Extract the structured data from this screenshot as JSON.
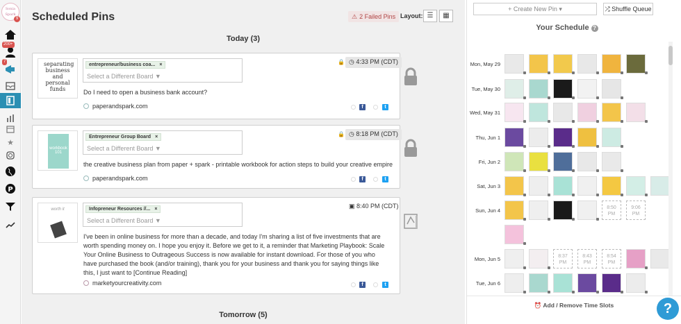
{
  "sidebar": {
    "logo_text": "Sonia Spark",
    "logo_badge": "9",
    "notif_badge": "200+",
    "tribes_badge": "7"
  },
  "header": {
    "title": "Scheduled Pins",
    "failed_pins": "2 Failed Pins",
    "layout_label": "Layout:"
  },
  "days": [
    {
      "label": "Today (3)"
    },
    {
      "label": "Tomorrow (5)"
    }
  ],
  "pins": [
    {
      "thumb_text": "separating business and personal funds",
      "board": "entrepreneur/business coa...",
      "board_placeholder": "Select a Different Board ▼",
      "time": "4:33 PM (CDT)",
      "description": "Do I need to open a business bank account?",
      "source": "paperandspark.com"
    },
    {
      "thumb_text": "workbook 101",
      "board": "Entrepreneur Group Board",
      "board_placeholder": "Select a Different Board ▼",
      "time": "8:18 PM (CDT)",
      "description": "the creative business plan from paper + spark - printable workbook for action steps to build your creative empire",
      "source": "paperandspark.com"
    },
    {
      "thumb_text": "worth it",
      "board": "Infopreneur Resources //...",
      "board_placeholder": "Select a Different Board ▼",
      "time": "8:40 PM (CDT)",
      "description": "I've been in online business for more than a decade, and today I'm sharing a list of five investments that are worth spending money on. I hope you enjoy it. Before we get to it, a reminder that Marketing Playbook: Scale Your Online Business to Outrageous Success is now available for instant download. For those of you who have purchased the book (and/or training), thank you for your business and thank you for saying things like this, I just want to [Continue Reading]",
      "source": "marketyourcreativity.com"
    }
  ],
  "schedule": {
    "create_label": "+ Create New Pin ▾",
    "shuffle_label": "Shuffle Queue",
    "title": "Your Schedule",
    "help": "?",
    "rows": [
      {
        "label": "Mon, May 29",
        "slots": [
          "#e9e9e9",
          "#f3c54a",
          "#f2c94c",
          "#e8e8e8",
          "#f0b43e",
          "#6b6b3c"
        ]
      },
      {
        "label": "Tue, May 30",
        "slots": [
          "#dfeee8",
          "#a9d8cf",
          "#1a1a1a",
          "#f2f2f2",
          "#e6e6e6"
        ]
      },
      {
        "label": "Wed, May 31",
        "slots": [
          "#f7e6f0",
          "#bfe6dd",
          "#e8e8e8",
          "#f0d0e0",
          "#f3c54a",
          "#f3dfe8"
        ]
      },
      {
        "label": "Thu, Jun 1",
        "slots": [
          "#6b4aa0",
          "#ececec",
          "#5a2c8a",
          "#efc040",
          "#cdebe3"
        ]
      },
      {
        "label": "Fri, Jun 2",
        "slots": [
          "#cfe6b8",
          "#e9e040",
          "#4f6e9a",
          "#e8e8e8",
          "#e9e9e9"
        ]
      },
      {
        "label": "Sat, Jun 3",
        "slots": [
          "#f3c54a",
          "#eeeeee",
          "#a9e2d6",
          "#f0f0f0",
          "#f4c842",
          "#d3eee6",
          "#d8ece8"
        ]
      },
      {
        "label": "Sun, Jun 4",
        "slots": [
          "#f3c54a",
          "#efefef",
          "#1a1a1a",
          "#f0f0f0"
        ],
        "empty": [
          "8:50 PM",
          "9:06 PM"
        ]
      },
      {
        "label": "",
        "slots": [
          "#f4c2dc"
        ]
      },
      {
        "label": "Mon, Jun 5",
        "slots": [
          "#efefef",
          "#f3eef0"
        ],
        "empty": [
          "8:37 PM",
          "8:43 PM",
          "8:54 PM"
        ],
        "tail": [
          "#e6a0c6",
          "#e9e9e9"
        ]
      },
      {
        "label": "Tue, Jun 6",
        "slots": [
          "#eeeeee",
          "#a9d8cf",
          "#a9e2d6",
          "#6b4aa0",
          "#5a2c8a",
          "#ececec"
        ]
      }
    ],
    "add_remove_label": "Add / Remove Time Slots"
  }
}
